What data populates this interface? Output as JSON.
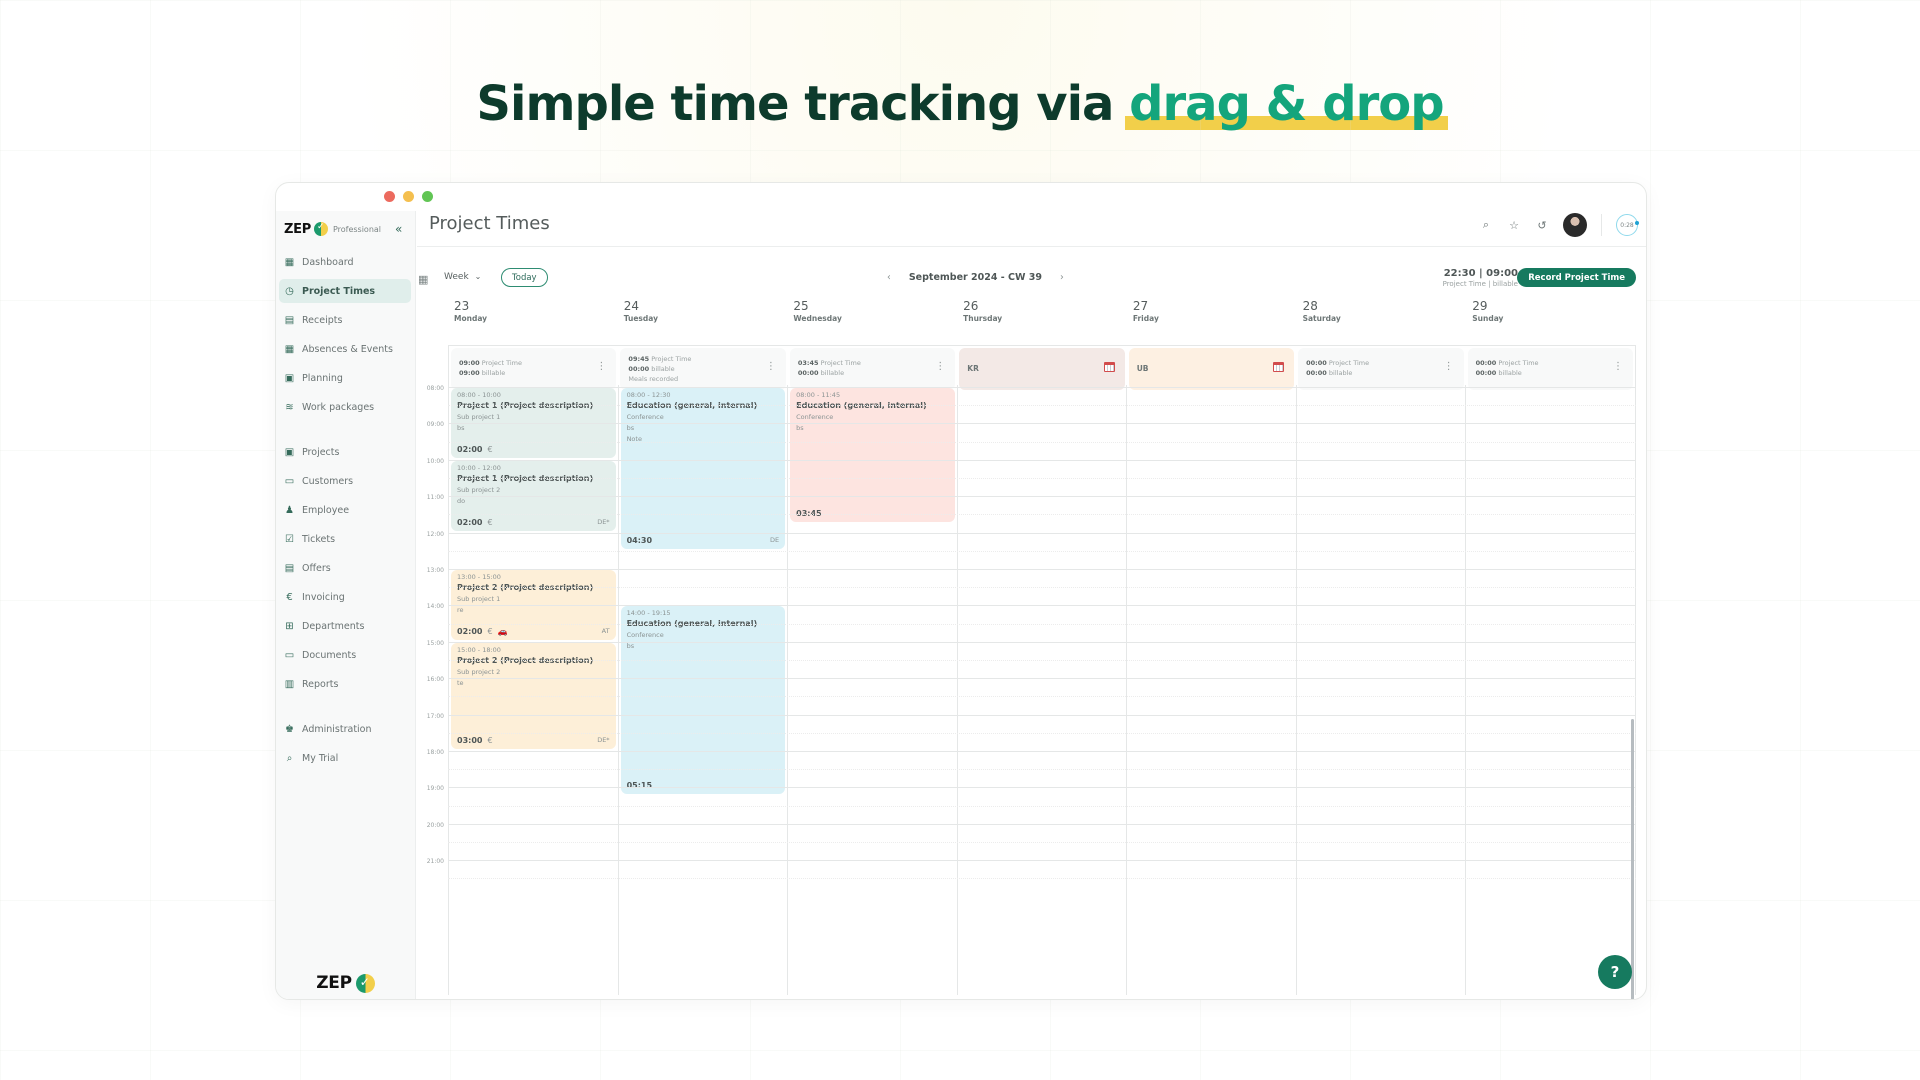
{
  "headline": {
    "prefix": "Simple time tracking via ",
    "accent": "drag & drop"
  },
  "sidebar": {
    "brand": "ZEP",
    "edition": "Professional",
    "collapse_icon": "double-chevron-left",
    "groups": [
      [
        {
          "label": "Dashboard",
          "icon": "dashboard-icon",
          "glyph": "▦",
          "active": false
        },
        {
          "label": "Project Times",
          "icon": "clipboard-clock-icon",
          "glyph": "◷",
          "active": true
        },
        {
          "label": "Receipts",
          "icon": "receipt-icon",
          "glyph": "▤",
          "active": false
        },
        {
          "label": "Absences & Events",
          "icon": "calendar-icon",
          "glyph": "▦",
          "active": false
        },
        {
          "label": "Planning",
          "icon": "planning-icon",
          "glyph": "▣",
          "active": false
        },
        {
          "label": "Work packages",
          "icon": "layers-icon",
          "glyph": "≋",
          "active": false
        }
      ],
      [
        {
          "label": "Projects",
          "icon": "projects-icon",
          "glyph": "▣",
          "active": false
        },
        {
          "label": "Customers",
          "icon": "contact-card-icon",
          "glyph": "▭",
          "active": false
        },
        {
          "label": "Employee",
          "icon": "people-icon",
          "glyph": "♟",
          "active": false
        },
        {
          "label": "Tickets",
          "icon": "ticket-check-icon",
          "glyph": "☑",
          "active": false
        },
        {
          "label": "Offers",
          "icon": "document-lines-icon",
          "glyph": "▤",
          "active": false
        },
        {
          "label": "Invoicing",
          "icon": "euro-icon",
          "glyph": "€",
          "active": false
        },
        {
          "label": "Departments",
          "icon": "hierarchy-icon",
          "glyph": "⊞",
          "active": false
        },
        {
          "label": "Documents",
          "icon": "folder-icon",
          "glyph": "▭",
          "active": false
        },
        {
          "label": "Reports",
          "icon": "bar-chart-icon",
          "glyph": "▥",
          "active": false
        }
      ],
      [
        {
          "label": "Administration",
          "icon": "admin-user-icon",
          "glyph": "♚",
          "active": false
        },
        {
          "label": "My Trial",
          "icon": "search-check-icon",
          "glyph": "⌕",
          "active": false
        }
      ]
    ]
  },
  "header": {
    "title": "Project Times",
    "timer": "0:28",
    "icons": [
      "search-icon",
      "star-icon",
      "history-icon"
    ]
  },
  "toolbar": {
    "view": "Week",
    "today": "Today",
    "period": "September 2024 - CW 39",
    "totals": "22:30 | 09:00",
    "totals_sub": "Project Time | billable",
    "record": "Record Project Time"
  },
  "days": [
    {
      "num": "23",
      "name": "Monday",
      "summary": {
        "type": "time",
        "project": "09:00",
        "billable": "09:00",
        "extra": ""
      }
    },
    {
      "num": "24",
      "name": "Tuesday",
      "summary": {
        "type": "time",
        "project": "09:45",
        "billable": "00:00",
        "extra": "Meals recorded"
      }
    },
    {
      "num": "25",
      "name": "Wednesday",
      "summary": {
        "type": "time",
        "project": "03:45",
        "billable": "00:00",
        "extra": ""
      }
    },
    {
      "num": "26",
      "name": "Thursday",
      "summary": {
        "type": "absence",
        "code": "KR",
        "variant": "kr"
      }
    },
    {
      "num": "27",
      "name": "Friday",
      "summary": {
        "type": "absence",
        "code": "UB",
        "variant": "ub"
      }
    },
    {
      "num": "28",
      "name": "Saturday",
      "summary": {
        "type": "time",
        "project": "00:00",
        "billable": "00:00",
        "extra": ""
      }
    },
    {
      "num": "29",
      "name": "Sunday",
      "summary": {
        "type": "time",
        "project": "00:00",
        "billable": "00:00",
        "extra": ""
      }
    }
  ],
  "labels": {
    "project_time": "Project Time",
    "billable": "billable"
  },
  "hours": [
    "08:00",
    "09:00",
    "10:00",
    "11:00",
    "12:00",
    "13:00",
    "14:00",
    "15:00",
    "16:00",
    "17:00",
    "18:00",
    "19:00",
    "20:00",
    "21:00"
  ],
  "events": [
    {
      "day": 0,
      "start": 8.0,
      "end": 10.0,
      "time": "08:00 - 10:00",
      "title": "Project 1 (Project description)",
      "lines": [
        "Sub project 1",
        "bs"
      ],
      "duration": "02:00",
      "symbols": [
        "€"
      ],
      "region": "",
      "color": "green"
    },
    {
      "day": 0,
      "start": 10.0,
      "end": 12.0,
      "time": "10:00 - 12:00",
      "title": "Project 1 (Project description)",
      "lines": [
        "Sub project 2",
        "do"
      ],
      "duration": "02:00",
      "symbols": [
        "€"
      ],
      "region": "DE*",
      "color": "green"
    },
    {
      "day": 0,
      "start": 13.0,
      "end": 15.0,
      "time": "13:00 - 15:00",
      "title": "Project 2 (Project description)",
      "lines": [
        "Sub project 1",
        "re"
      ],
      "duration": "02:00",
      "symbols": [
        "€",
        "🚗"
      ],
      "region": "AT",
      "color": "orange"
    },
    {
      "day": 0,
      "start": 15.0,
      "end": 18.0,
      "time": "15:00 - 18:00",
      "title": "Project 2 (Project description)",
      "lines": [
        "Sub project 2",
        "te"
      ],
      "duration": "03:00",
      "symbols": [
        "€"
      ],
      "region": "DE*",
      "color": "orange"
    },
    {
      "day": 1,
      "start": 8.0,
      "end": 12.5,
      "time": "08:00 - 12:30",
      "title": "Education (general, internal)",
      "lines": [
        "Conference",
        "bs",
        "Note"
      ],
      "duration": "04:30",
      "symbols": [],
      "region": "DE",
      "color": "blue"
    },
    {
      "day": 1,
      "start": 14.0,
      "end": 19.25,
      "time": "14:00 - 19:15",
      "title": "Education (general, internal)",
      "lines": [
        "Conference",
        "bs"
      ],
      "duration": "05:15",
      "symbols": [],
      "region": "",
      "color": "blue"
    },
    {
      "day": 2,
      "start": 8.0,
      "end": 11.75,
      "time": "08:00 - 11:45",
      "title": "Education (general, internal)",
      "lines": [
        "Conference",
        "bs"
      ],
      "duration": "03:45",
      "symbols": [],
      "region": "",
      "color": "pink"
    }
  ],
  "help": "?"
}
